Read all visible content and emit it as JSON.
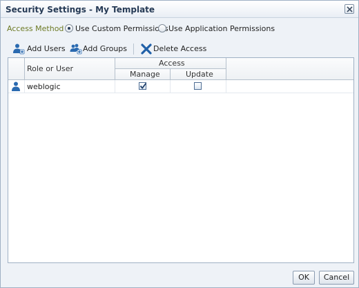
{
  "dialog": {
    "title": "Security Settings - My Template"
  },
  "access_method": {
    "label": "Access Method",
    "options": [
      {
        "label": "Use Custom Permissions",
        "selected": true
      },
      {
        "label": "Use Application Permissions",
        "selected": false
      }
    ]
  },
  "toolbar": {
    "add_users": "Add Users",
    "add_groups": "Add Groups",
    "delete_access": "Delete Access"
  },
  "table": {
    "headers": {
      "role": "Role or User",
      "access": "Access",
      "manage": "Manage",
      "update": "Update"
    },
    "rows": [
      {
        "name": "weblogic",
        "manage": true,
        "update": false
      }
    ]
  },
  "buttons": {
    "ok": "OK",
    "cancel": "Cancel"
  },
  "colors": {
    "accent": "#2a6ab0",
    "access_label": "#6d7a25",
    "delete_icon": "#2060a8"
  }
}
